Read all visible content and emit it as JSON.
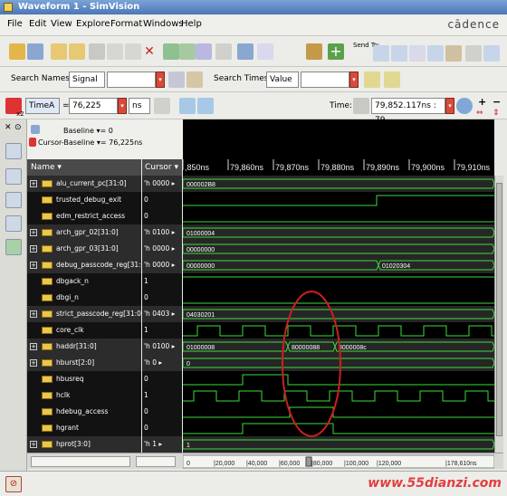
{
  "window": {
    "title": "Waveform 1 - SimVision"
  },
  "menu": [
    "File",
    "Edit",
    "View",
    "Explore",
    "Format",
    "Windows",
    "Help"
  ],
  "brand": "cādence",
  "toolbar": {
    "send_to": "Send To:",
    "search_names_label": "Search Names:",
    "search_names_value": "Signal",
    "search_times_label": "Search Times:",
    "search_times_value": "Value",
    "x2": "x2",
    "timeA_label": "TimeA",
    "timeA_eq": "=",
    "timeA_value": "76,225",
    "time_unit": "ns",
    "time_label": "Time:",
    "time_value": "79,852.117ns : 79,"
  },
  "cursor_info": {
    "baseline": "Baseline ▾= 0",
    "cursor_baseline": "Cursor-Baseline ▾= 76,225ns"
  },
  "headers": {
    "name": "Name ▾",
    "cursor": "Cursor ▾"
  },
  "timeline": {
    "labels": [
      ",850ns",
      "79,860ns",
      "79,870ns",
      "79,880ns",
      "79,890ns",
      "79,900ns",
      "79,910ns"
    ]
  },
  "signals": [
    {
      "name": "alu_current_pc[31:0]",
      "bus": true,
      "cursor": "'h 0000",
      "wave": "bus",
      "values": [
        "000002B8"
      ]
    },
    {
      "name": "trusted_debug_exit",
      "bus": false,
      "cursor": "0",
      "wave": "bit",
      "edges": [
        0.0,
        0
      ],
      "levels": [
        [
          0,
          0
        ],
        [
          0.62,
          1
        ]
      ]
    },
    {
      "name": "edm_restrict_access",
      "bus": false,
      "cursor": "0",
      "wave": "bit",
      "levels": [
        [
          0,
          0
        ]
      ]
    },
    {
      "name": "arch_gpr_02[31:0]",
      "bus": true,
      "cursor": "'h 0100",
      "wave": "bus",
      "values": [
        "01000004"
      ]
    },
    {
      "name": "arch_gpr_03[31:0]",
      "bus": true,
      "cursor": "'h 0000",
      "wave": "bus",
      "values": [
        "00000000"
      ]
    },
    {
      "name": "debug_passcode_reg[31:0]",
      "bus": true,
      "cursor": "'h 0000",
      "wave": "bus",
      "values": [
        "00000000",
        "01020304"
      ]
    },
    {
      "name": "dbgack_n",
      "bus": false,
      "cursor": "1",
      "wave": "bit",
      "levels": [
        [
          0,
          1
        ]
      ]
    },
    {
      "name": "dbgi_n",
      "bus": false,
      "cursor": "0",
      "wave": "bit",
      "levels": [
        [
          0,
          0
        ]
      ]
    },
    {
      "name": "strict_passcode_reg[31:0]",
      "bus": true,
      "cursor": "'h 0403",
      "wave": "bus",
      "values": [
        "04030201"
      ]
    },
    {
      "name": "core_clk",
      "bus": false,
      "cursor": "1",
      "wave": "clk"
    },
    {
      "name": "haddr[31:0]",
      "bus": true,
      "cursor": "'h 0100",
      "wave": "bus",
      "values": [
        "01000008",
        "80000088",
        "8000008c"
      ]
    },
    {
      "name": "hburst[2:0]",
      "bus": true,
      "cursor": "'h 0",
      "wave": "bus",
      "values": [
        "0"
      ]
    },
    {
      "name": "hbusreq",
      "bus": false,
      "cursor": "0",
      "wave": "bit"
    },
    {
      "name": "hclk",
      "bus": false,
      "cursor": "1",
      "wave": "clk2"
    },
    {
      "name": "hdebug_access",
      "bus": false,
      "cursor": "0",
      "wave": "bit"
    },
    {
      "name": "hgrant",
      "bus": false,
      "cursor": "0",
      "wave": "bit"
    },
    {
      "name": "hprot[3:0]",
      "bus": true,
      "cursor": "'h 1",
      "wave": "bus",
      "values": [
        "1"
      ]
    }
  ],
  "bottom_scale": [
    "0",
    "20,000",
    "40,000",
    "60,000",
    "80,000",
    "100,000",
    "120,000",
    "178,610ns"
  ],
  "watermark": "www.55dianzi.com",
  "colors": {
    "wave": "#3ddc3d",
    "bus_text": "#ffffff",
    "highlight": "#cc1f1f",
    "background": "#000000"
  }
}
